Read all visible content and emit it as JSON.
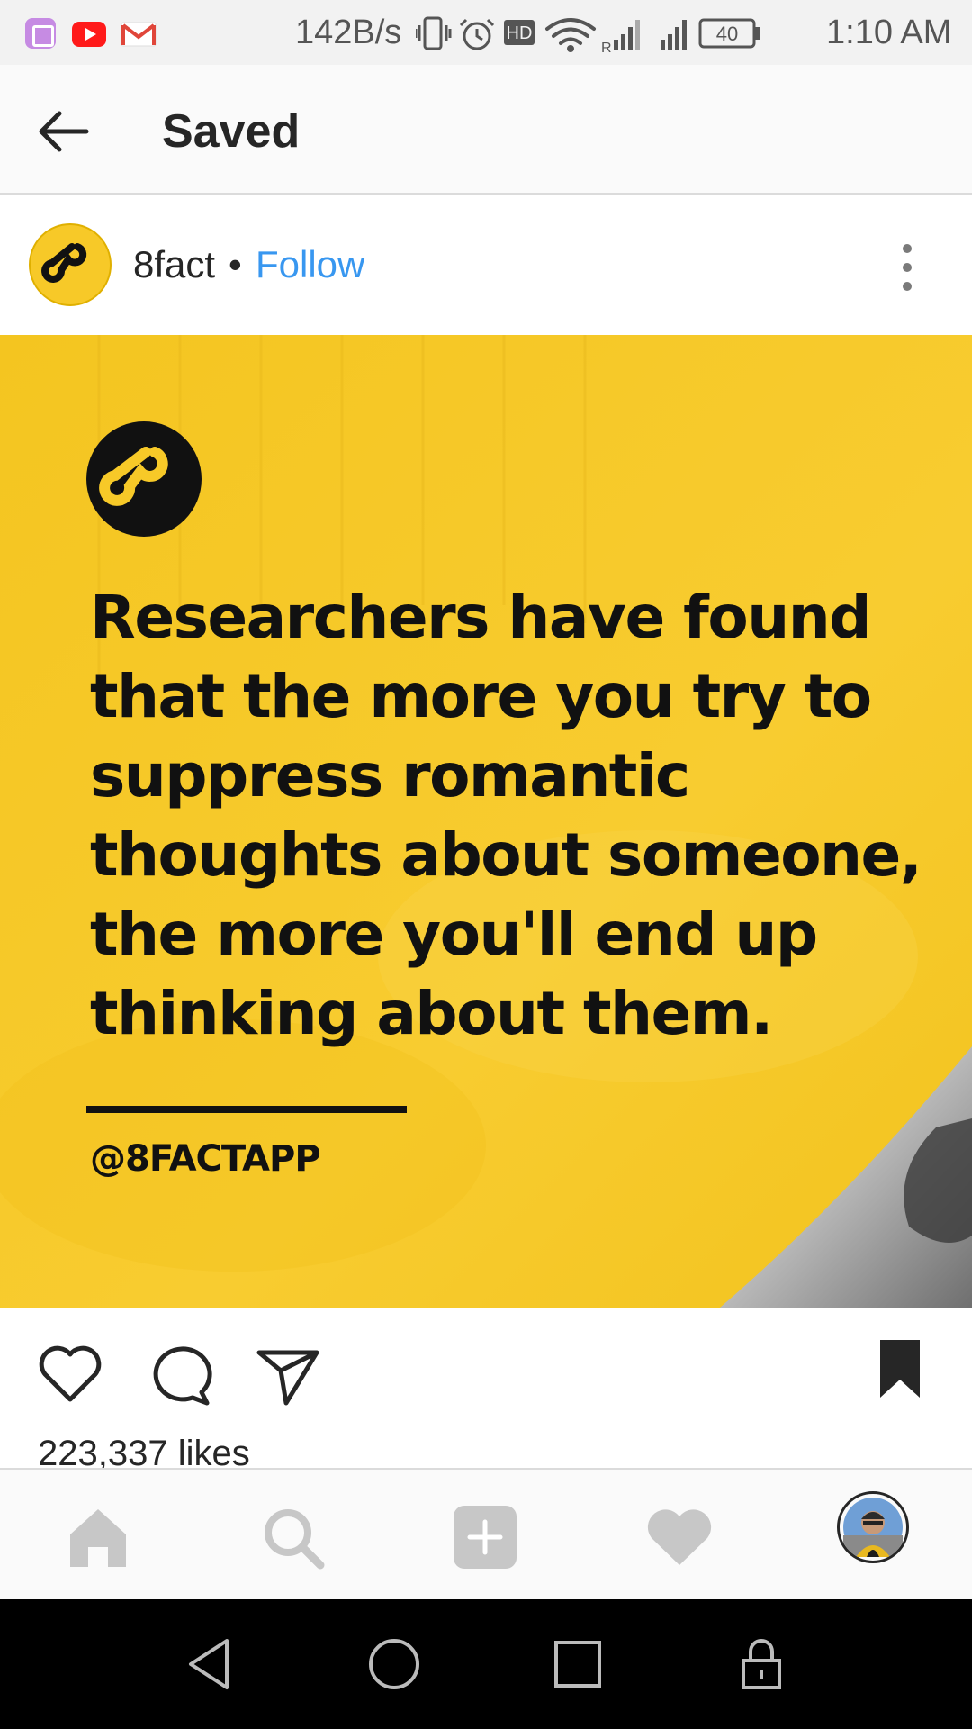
{
  "status_bar": {
    "net_speed": "142B/s",
    "battery": "40",
    "time": "1:10 AM",
    "hd_badge": "HD",
    "roaming_badge": "R",
    "icons": [
      "gallery-icon",
      "youtube-icon",
      "gmail-icon",
      "vibrate-icon",
      "alarm-icon",
      "hd-icon",
      "wifi-icon",
      "signal-roaming-icon",
      "signal-icon",
      "battery-icon"
    ]
  },
  "header": {
    "title": "Saved"
  },
  "post": {
    "author": "8fact",
    "separator": "•",
    "follow_label": "Follow",
    "image": {
      "text_lines": [
        "Researchers have found",
        "that the more you try to",
        "suppress romantic",
        "thoughts about someone,",
        "the more you'll end up",
        "thinking about them."
      ],
      "handle": "@8FACTAPP"
    },
    "likes": "223,337 likes"
  },
  "colors": {
    "brand_yellow": "#f7c928",
    "follow_blue": "#3897f0",
    "text_dark": "#262626",
    "nav_gray": "#c7c7c7"
  }
}
